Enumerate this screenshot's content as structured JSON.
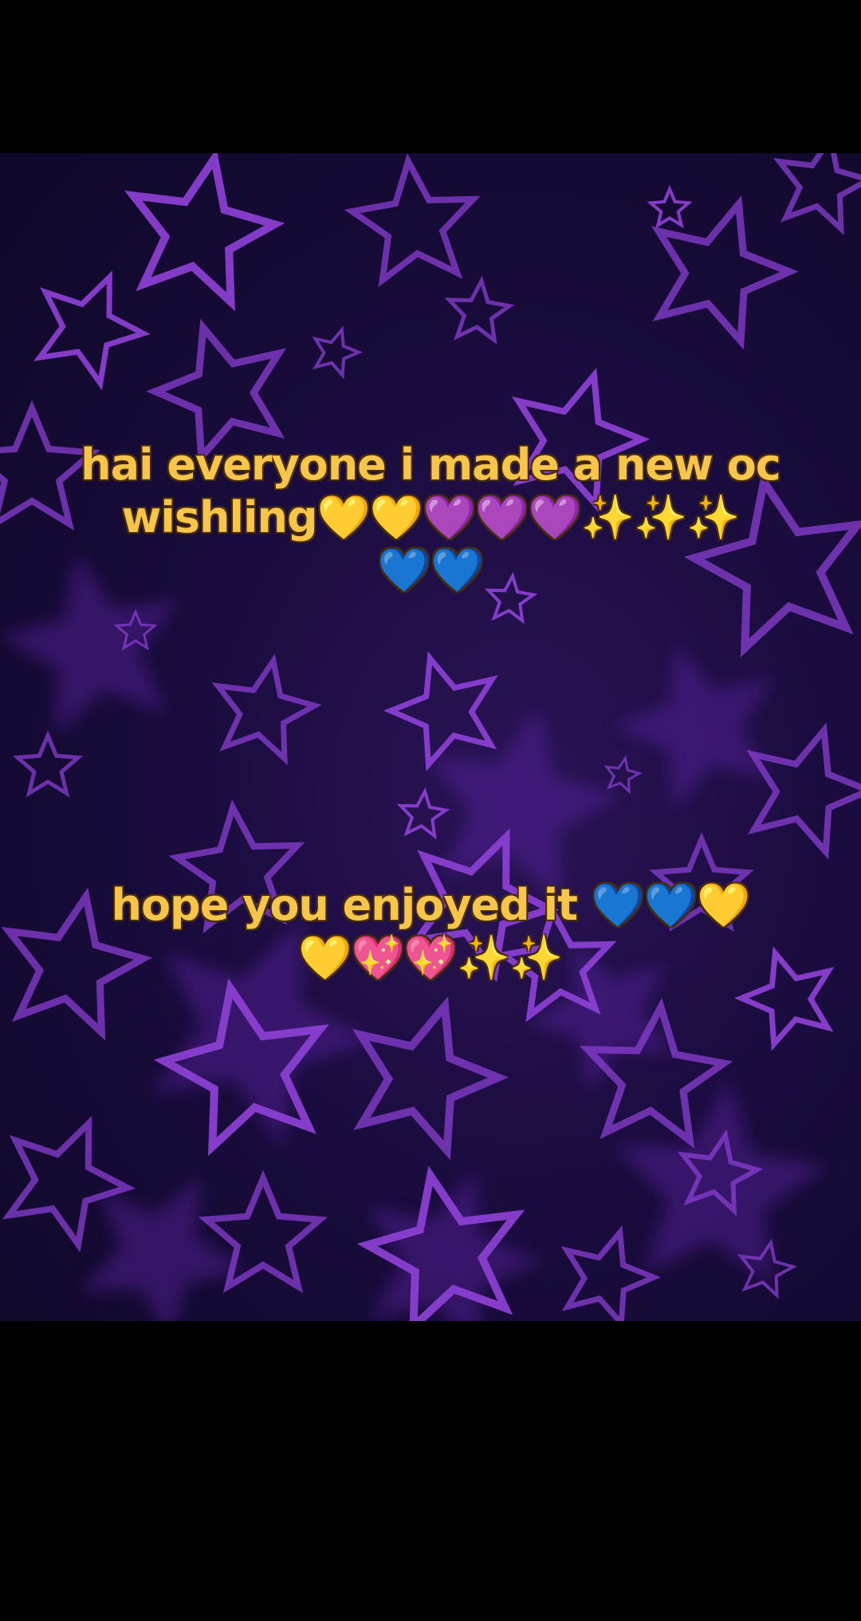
{
  "background": {
    "outer_color": "#000000",
    "star_color": "#8a3fd1",
    "star_dark_color": "#5b24a3",
    "base_color": "#1a0c3e"
  },
  "captions": {
    "first": "hai everyone i made a new oc wishling💛💛💜💜💜✨✨✨\n💙💙",
    "second": "hope you enjoyed it 💙💙💛\n💛💖💖✨✨"
  },
  "caption_style": {
    "fill_color": "#f6c54a",
    "outline_color": "#5a3a10"
  }
}
